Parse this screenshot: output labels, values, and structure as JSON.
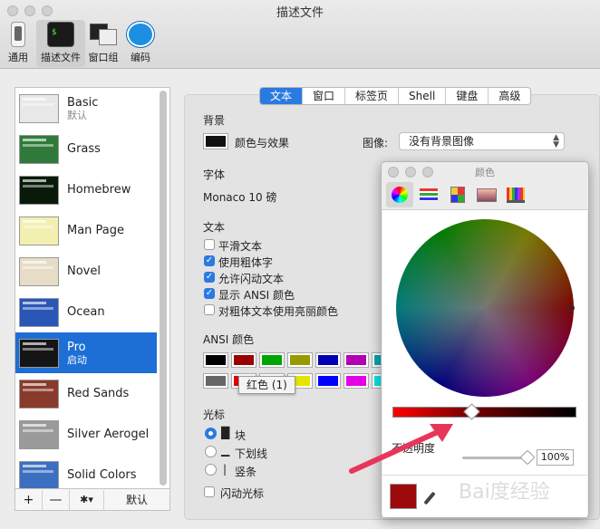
{
  "window": {
    "title": "描述文件"
  },
  "toolbar": {
    "items": [
      {
        "label": "通用",
        "icon": "toggle-icon"
      },
      {
        "label": "描述文件",
        "icon": "terminal-profile-icon"
      },
      {
        "label": "窗口组",
        "icon": "window-group-icon"
      },
      {
        "label": "编码",
        "icon": "globe-icon"
      }
    ]
  },
  "profiles": [
    {
      "name": "Basic",
      "sub": "默认",
      "color": "#e8e8e8"
    },
    {
      "name": "Grass",
      "sub": "",
      "color": "#2f7a3b"
    },
    {
      "name": "Homebrew",
      "sub": "",
      "color": "#0a1a0a"
    },
    {
      "name": "Man Page",
      "sub": "",
      "color": "#f3efb0"
    },
    {
      "name": "Novel",
      "sub": "",
      "color": "#e7dcc6"
    },
    {
      "name": "Ocean",
      "sub": "",
      "color": "#2a56b8"
    },
    {
      "name": "Pro",
      "sub": "启动",
      "color": "#151515"
    },
    {
      "name": "Red Sands",
      "sub": "",
      "color": "#8a3a2a"
    },
    {
      "name": "Silver Aerogel",
      "sub": "",
      "color": "#9a9a9a"
    },
    {
      "name": "Solid Colors",
      "sub": "",
      "color": "#3c6fc0"
    }
  ],
  "list_controls": {
    "add": "+",
    "remove": "—",
    "gear": "✱▾",
    "default": "默认"
  },
  "tabs": [
    "文本",
    "窗口",
    "标签页",
    "Shell",
    "键盘",
    "高级"
  ],
  "settings": {
    "background": {
      "label": "背景",
      "swatch_label": "颜色与效果",
      "image_label": "图像:",
      "image_value": "没有背景图像"
    },
    "font": {
      "label": "字体",
      "value": "Monaco 10 磅"
    },
    "text": {
      "label": "文本",
      "options": [
        {
          "label": "平滑文本",
          "checked": false
        },
        {
          "label": "使用粗体字",
          "checked": true
        },
        {
          "label": "允许闪动文本",
          "checked": true
        },
        {
          "label": "显示 ANSI 颜色",
          "checked": true
        },
        {
          "label": "对粗体文本使用亮丽颜色",
          "checked": false
        }
      ]
    },
    "ansi": {
      "label": "ANSI 颜色",
      "row1": [
        "#000000",
        "#990000",
        "#00a600",
        "#999900",
        "#0000b2",
        "#b200b2",
        "#00a6b2"
      ],
      "row2": [
        "#666666",
        "#e50000",
        "#00d900",
        "#e5e500",
        "#0000ff",
        "#e500e5",
        "#00e5e5"
      ],
      "tooltip": "红色 (1)"
    },
    "cursor": {
      "label": "光标",
      "options": [
        {
          "label": "块",
          "glyph": "█",
          "selected": true
        },
        {
          "label": "下划线",
          "glyph": "▁",
          "selected": false
        },
        {
          "label": "竖条",
          "glyph": "|",
          "selected": false
        }
      ],
      "blink": "闪动光标"
    }
  },
  "color_panel": {
    "title": "颜色",
    "opacity_label": "不透明度",
    "opacity_value": "100%",
    "brightness": 0.43,
    "opacity": 1.0,
    "current_color": "#9c0a0c"
  },
  "watermark": "Bai度经验"
}
